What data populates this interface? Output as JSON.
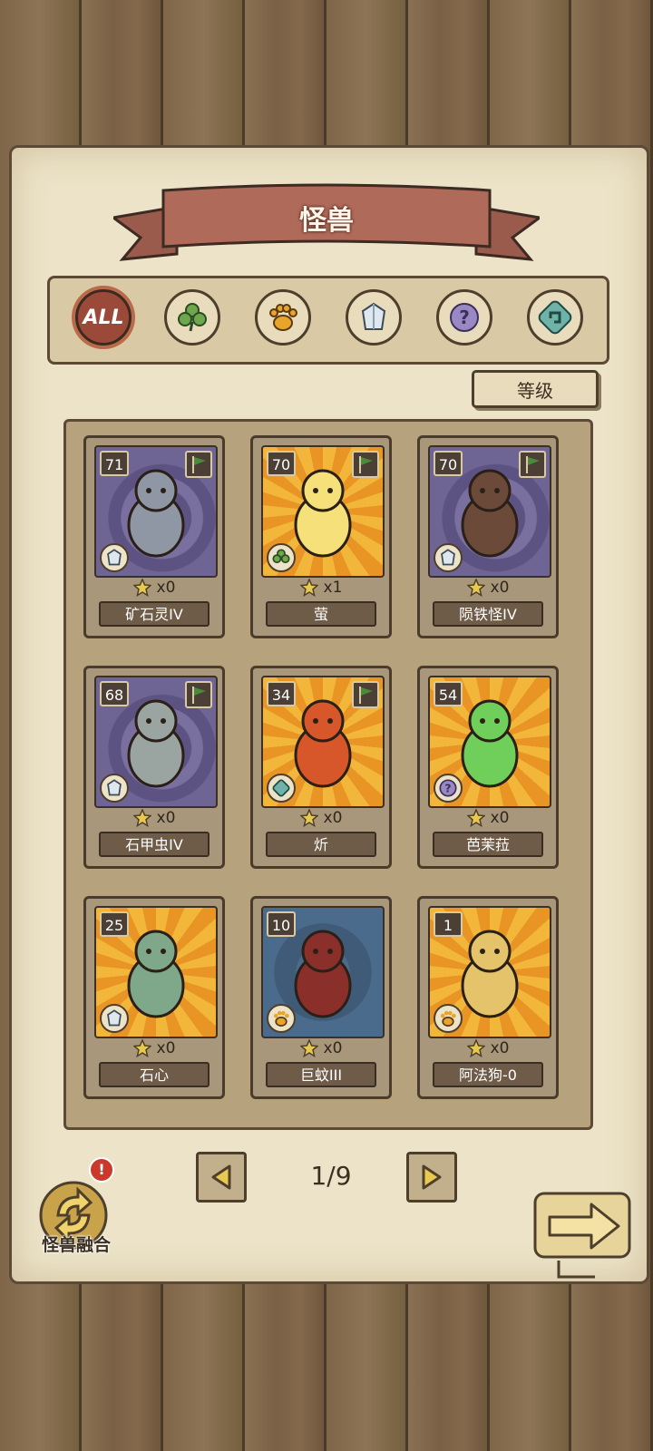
{
  "screen": {
    "title": "怪兽",
    "filters": [
      {
        "key": "all",
        "label": "ALL",
        "icon": "all-icon",
        "active": true
      },
      {
        "key": "plant",
        "icon": "clover-icon",
        "active": false
      },
      {
        "key": "beast",
        "icon": "paw-icon",
        "active": false
      },
      {
        "key": "mineral",
        "icon": "crystal-icon",
        "active": false
      },
      {
        "key": "unknown",
        "icon": "question-icon",
        "active": false
      },
      {
        "key": "special",
        "icon": "spiral-icon",
        "active": false
      }
    ],
    "sort_label": "等级"
  },
  "cards": [
    {
      "level": "71",
      "count": "x0",
      "name": "矿石灵IV",
      "type_icon": "crystal-icon",
      "bg": "purple",
      "flag": true
    },
    {
      "level": "70",
      "count": "x1",
      "name": "萤",
      "type_icon": "clover-icon",
      "bg": "sun",
      "flag": true
    },
    {
      "level": "70",
      "count": "x0",
      "name": "陨铁怪IV",
      "type_icon": "crystal-icon",
      "bg": "purple",
      "flag": true
    },
    {
      "level": "68",
      "count": "x0",
      "name": "石甲虫IV",
      "type_icon": "crystal-icon",
      "bg": "purple",
      "flag": true
    },
    {
      "level": "34",
      "count": "x0",
      "name": "炘",
      "type_icon": "spiral-icon",
      "bg": "sun",
      "flag": true
    },
    {
      "level": "54",
      "count": "x0",
      "name": "芭茉菈",
      "type_icon": "question-icon",
      "bg": "sun",
      "flag": false
    },
    {
      "level": "25",
      "count": "x0",
      "name": "石心",
      "type_icon": "crystal-icon",
      "bg": "sun",
      "flag": false
    },
    {
      "level": "10",
      "count": "x0",
      "name": "巨蚊III",
      "type_icon": "paw-icon",
      "bg": "blue",
      "flag": false
    },
    {
      "level": "1",
      "count": "x0",
      "name": "阿法狗-0",
      "type_icon": "paw-icon",
      "bg": "sun",
      "flag": false
    }
  ],
  "pager": {
    "indicator": "1/9"
  },
  "fusion": {
    "label": "怪兽融合",
    "badge": "!"
  },
  "colors": {
    "parchment": "#ece3c8",
    "banner": "#b06a5a",
    "frame": "#5c4a36",
    "accent_red": "#9b4a3a",
    "flag_green": "#4b8a3a"
  }
}
